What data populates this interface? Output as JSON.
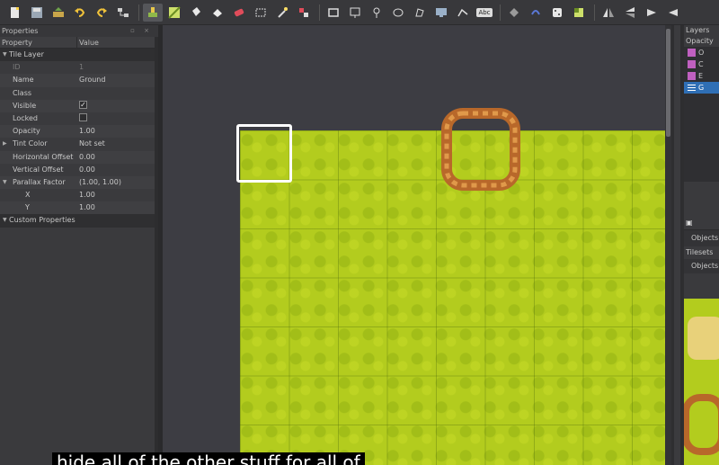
{
  "toolbar": {
    "icons": [
      "new-map-icon",
      "save-icon",
      "export-icon",
      "undo-icon",
      "redo-icon",
      "commands-icon",
      "stamp-brush-icon",
      "terrain-brush-icon",
      "bucket-fill-icon",
      "shape-fill-icon",
      "eraser-icon",
      "rectangle-select-icon",
      "magic-wand-icon",
      "select-same-tile-icon",
      "rectangle-object-icon",
      "point-object-icon",
      "ellipse-object-icon",
      "polygon-object-icon",
      "tile-object-icon",
      "template-icon",
      "text-object-icon",
      "rotate-left-icon",
      "rotate-right-icon",
      "flip-horizontal-icon",
      "flip-vertical-icon"
    ],
    "text_tool_label": "Abc"
  },
  "properties": {
    "title": "Properties",
    "col_property": "Property",
    "col_value": "Value",
    "group_tile_layer": "Tile Layer",
    "rows": [
      {
        "key": "ID",
        "value": "1"
      },
      {
        "key": "Name",
        "value": "Ground"
      },
      {
        "key": "Class",
        "value": ""
      },
      {
        "key": "Visible",
        "value": "✓"
      },
      {
        "key": "Locked",
        "value": ""
      },
      {
        "key": "Opacity",
        "value": "1.00"
      },
      {
        "key": "Tint Color",
        "value": "Not set"
      },
      {
        "key": "Horizontal Offset",
        "value": "0.00"
      },
      {
        "key": "Vertical Offset",
        "value": "0.00"
      },
      {
        "key": "Parallax Factor",
        "value": "(1.00, 1.00)"
      },
      {
        "key": "X",
        "value": "1.00"
      },
      {
        "key": "Y",
        "value": "1.00"
      }
    ],
    "group_custom": "Custom Properties"
  },
  "layers": {
    "title": "Layers",
    "opacity_label": "Opacity",
    "items": [
      {
        "name": "O"
      },
      {
        "name": "C"
      },
      {
        "name": "E"
      },
      {
        "name": "G"
      }
    ]
  },
  "objects_tabs": {
    "tab1": "Objects",
    "tilesets_label": "Tilesets",
    "tab2": "Objects"
  },
  "subtitle": "hide all of the other stuff for all of",
  "colors": {
    "grass": "#b3cc1e",
    "selection": "#2f6fb5",
    "ring": "#b8682a"
  }
}
